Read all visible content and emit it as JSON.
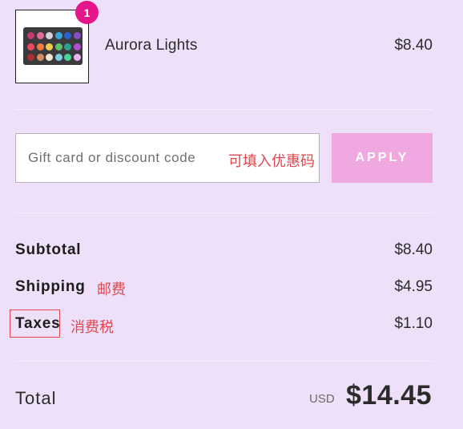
{
  "cart": {
    "item": {
      "name": "Aurora Lights",
      "price": "$8.40",
      "quantity": "1",
      "thumbnail_icon": "eyeshadow-palette-image"
    }
  },
  "discount": {
    "placeholder": "Gift card or discount code",
    "apply_label": "APPLY",
    "annotation": "可填入优惠码"
  },
  "summary": {
    "subtotal": {
      "label": "Subtotal",
      "value": "$8.40"
    },
    "shipping": {
      "label": "Shipping",
      "value": "$4.95",
      "annotation": "邮费"
    },
    "taxes": {
      "label": "Taxes",
      "value": "$1.10",
      "annotation": "消费税"
    }
  },
  "total": {
    "label": "Total",
    "currency": "USD",
    "amount": "$14.45"
  },
  "colors": {
    "background": "#ede0f8",
    "badge": "#e4178a",
    "apply_button": "#efa9e0",
    "annotation": "#e0464d"
  }
}
